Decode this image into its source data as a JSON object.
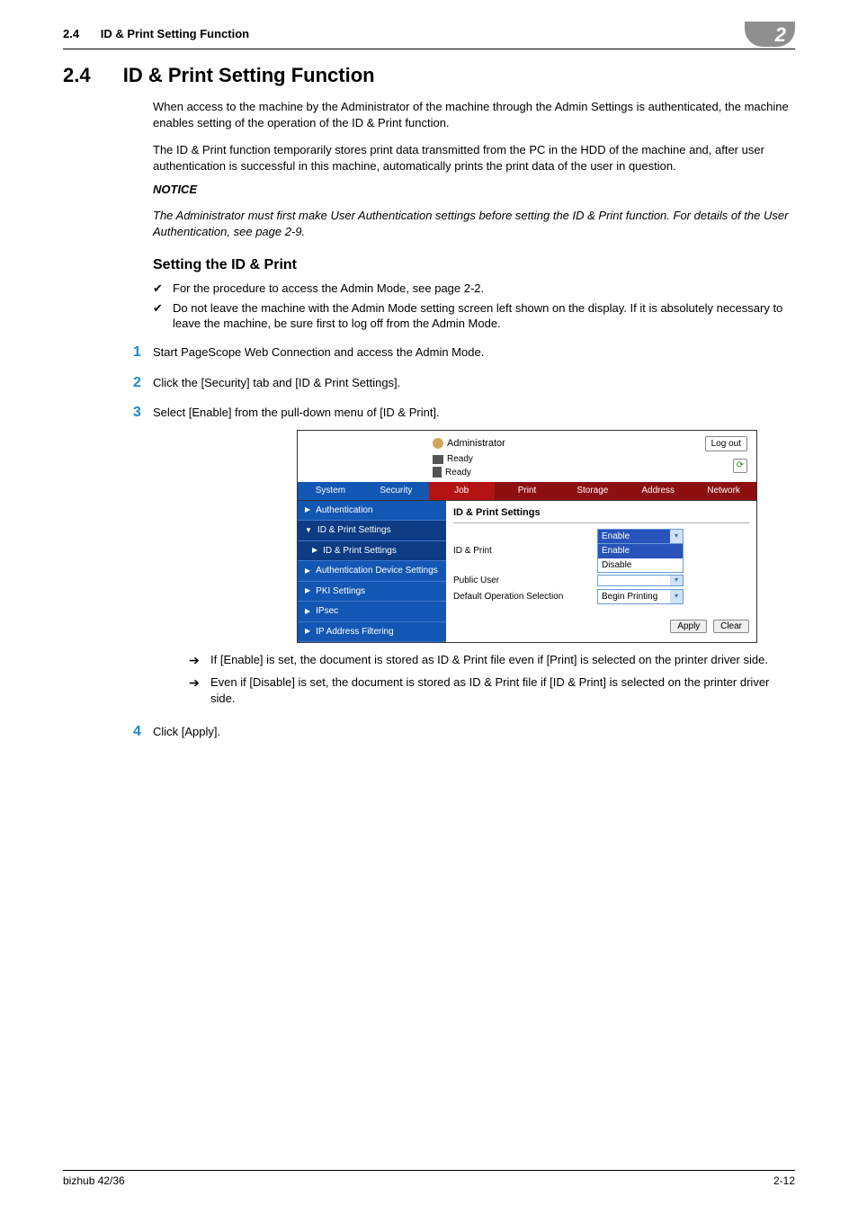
{
  "running_header": {
    "section_num": "2.4",
    "section_title": "ID & Print Setting Function",
    "chapter": "2"
  },
  "title": {
    "num": "2.4",
    "text": "ID & Print Setting Function"
  },
  "intro1": "When access to the machine by the Administrator of the machine through the Admin Settings is authenticated, the machine enables setting of the operation of the ID & Print function.",
  "intro2": "The ID & Print function temporarily stores print data transmitted from the PC in the HDD of the machine and, after user authentication is successful in this machine, automatically prints the print data of the user in question.",
  "notice_label": "NOTICE",
  "notice_text": "The Administrator must first make User Authentication settings before setting the ID & Print function. For details of the User Authentication, see page 2-9.",
  "subsection": "Setting the ID & Print",
  "checks": [
    "For the procedure to access the Admin Mode, see page 2-2.",
    "Do not leave the machine with the Admin Mode setting screen left shown on the display. If it is absolutely necessary to leave the machine, be sure first to log off from the Admin Mode."
  ],
  "steps": [
    "Start PageScope Web Connection and access the Admin Mode.",
    "Click the [Security] tab and [ID & Print Settings].",
    "Select [Enable] from the pull-down menu of [ID & Print].",
    "Click [Apply]."
  ],
  "arrows": [
    "If [Enable] is set, the document is stored as ID & Print file even if [Print] is selected on the printer driver side.",
    "Even if [Disable] is set, the document is stored as ID & Print file if [ID & Print] is selected on the printer driver side."
  ],
  "screenshot": {
    "user": "Administrator",
    "logout": "Log out",
    "status": [
      "Ready",
      "Ready"
    ],
    "tabs": [
      "System",
      "Security",
      "Job",
      "Print",
      "Storage",
      "Address",
      "Network"
    ],
    "active_tab_index": 1,
    "nav": [
      {
        "label": "Authentication",
        "marker": "▶",
        "level": 1
      },
      {
        "label": "ID & Print Settings",
        "marker": "▼",
        "level": 1,
        "dark": true
      },
      {
        "label": "ID & Print Settings",
        "marker": "▶",
        "level": 2,
        "dark": true
      },
      {
        "label": "Authentication Device Settings",
        "marker": "▶",
        "level": 1
      },
      {
        "label": "PKI Settings",
        "marker": "▶",
        "level": 1
      },
      {
        "label": "IPsec",
        "marker": "▶",
        "level": 1
      },
      {
        "label": "IP Address Filtering",
        "marker": "▶",
        "level": 1
      }
    ],
    "content_title": "ID & Print Settings",
    "rows": [
      {
        "label": "ID & Print",
        "type": "select-open",
        "value": "Enable",
        "options": [
          "Enable",
          "Disable"
        ]
      },
      {
        "label": "Public User",
        "type": "select",
        "value": ""
      },
      {
        "label": "Default Operation Selection",
        "type": "select",
        "value": "Begin Printing"
      }
    ],
    "buttons": [
      "Apply",
      "Clear"
    ]
  },
  "footer": {
    "left": "bizhub 42/36",
    "right": "2-12"
  }
}
